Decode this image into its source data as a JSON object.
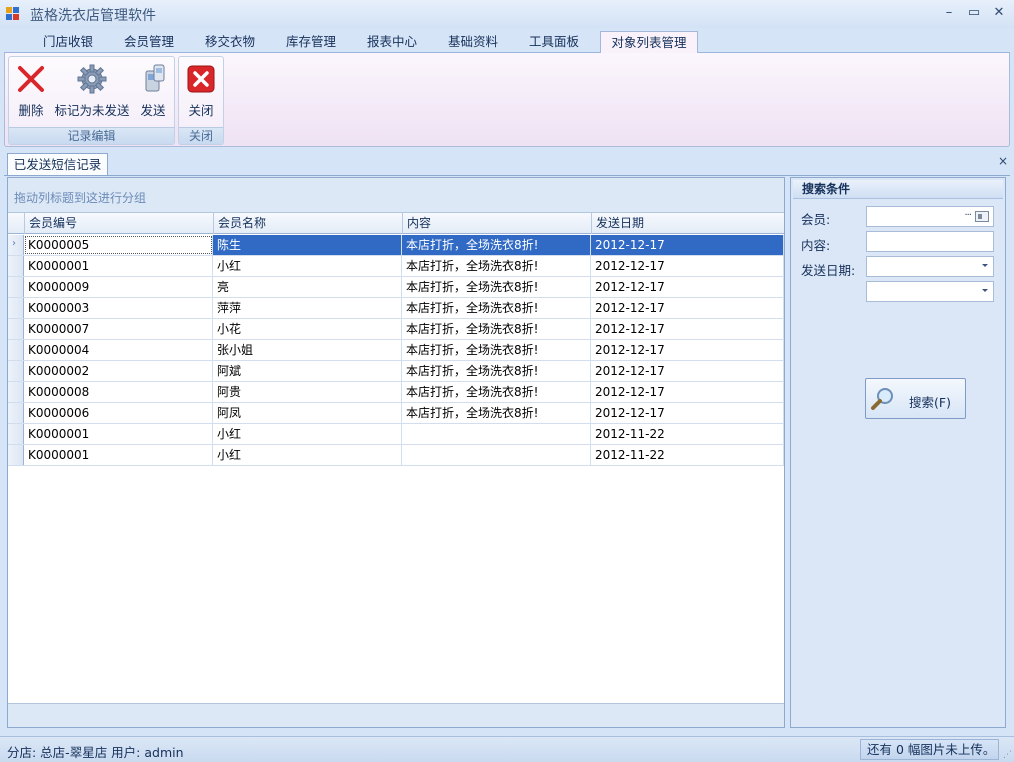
{
  "window": {
    "title": "蓝格洗衣店管理软件",
    "minimize": "–",
    "maximize": "▭",
    "close": "✕"
  },
  "tabs": [
    "门店收银",
    "会员管理",
    "移交衣物",
    "库存管理",
    "报表中心",
    "基础资料",
    "工具面板",
    "对象列表管理"
  ],
  "active_tab": "对象列表管理",
  "ribbon": {
    "groups": [
      {
        "label": "记录编辑",
        "buttons": [
          "删除",
          "标记为未发送",
          "发送"
        ]
      },
      {
        "label": "关闭",
        "buttons": [
          "关闭"
        ]
      }
    ]
  },
  "document_tab": {
    "title": "已发送短信记录",
    "close": "×"
  },
  "grid": {
    "group_hint": "拖动列标题到这进行分组",
    "columns": [
      "会员编号",
      "会员名称",
      "内容",
      "发送日期"
    ],
    "selected_index": 0,
    "rows": [
      [
        "K0000005",
        "陈生",
        "本店打折，全场洗衣8折!",
        "2012-12-17"
      ],
      [
        "K0000001",
        "小红",
        "本店打折，全场洗衣8折!",
        "2012-12-17"
      ],
      [
        "K0000009",
        "亮",
        "本店打折，全场洗衣8折!",
        "2012-12-17"
      ],
      [
        "K0000003",
        "萍萍",
        "本店打折，全场洗衣8折!",
        "2012-12-17"
      ],
      [
        "K0000007",
        "小花",
        "本店打折，全场洗衣8折!",
        "2012-12-17"
      ],
      [
        "K0000004",
        "张小姐",
        "本店打折，全场洗衣8折!",
        "2012-12-17"
      ],
      [
        "K0000002",
        "阿斌",
        "本店打折，全场洗衣8折!",
        "2012-12-17"
      ],
      [
        "K0000008",
        "阿贵",
        "本店打折，全场洗衣8折!",
        "2012-12-17"
      ],
      [
        "K0000006",
        "阿凤",
        "本店打折，全场洗衣8折!",
        "2012-12-17"
      ],
      [
        "K0000001",
        "小红",
        "",
        "2012-11-22"
      ],
      [
        "K0000001",
        "小红",
        "",
        "2012-11-22"
      ]
    ]
  },
  "search": {
    "title": "搜索条件",
    "member_label": "会员:",
    "member_value": "",
    "member_dots": "···",
    "content_label": "内容:",
    "content_value": "",
    "date_label": "发送日期:",
    "date_from": "",
    "date_to": "",
    "button_label": "搜索(F)"
  },
  "status": {
    "left": "分店: 总店-翠星店 用户: admin",
    "right": "还有 0 幅图片未上传。"
  },
  "colors": {
    "selection": "#316ac5",
    "ribbon_bg": "#f4ecf8",
    "frame_bg": "#d6e4f7",
    "delete_red": "#d9262b"
  }
}
